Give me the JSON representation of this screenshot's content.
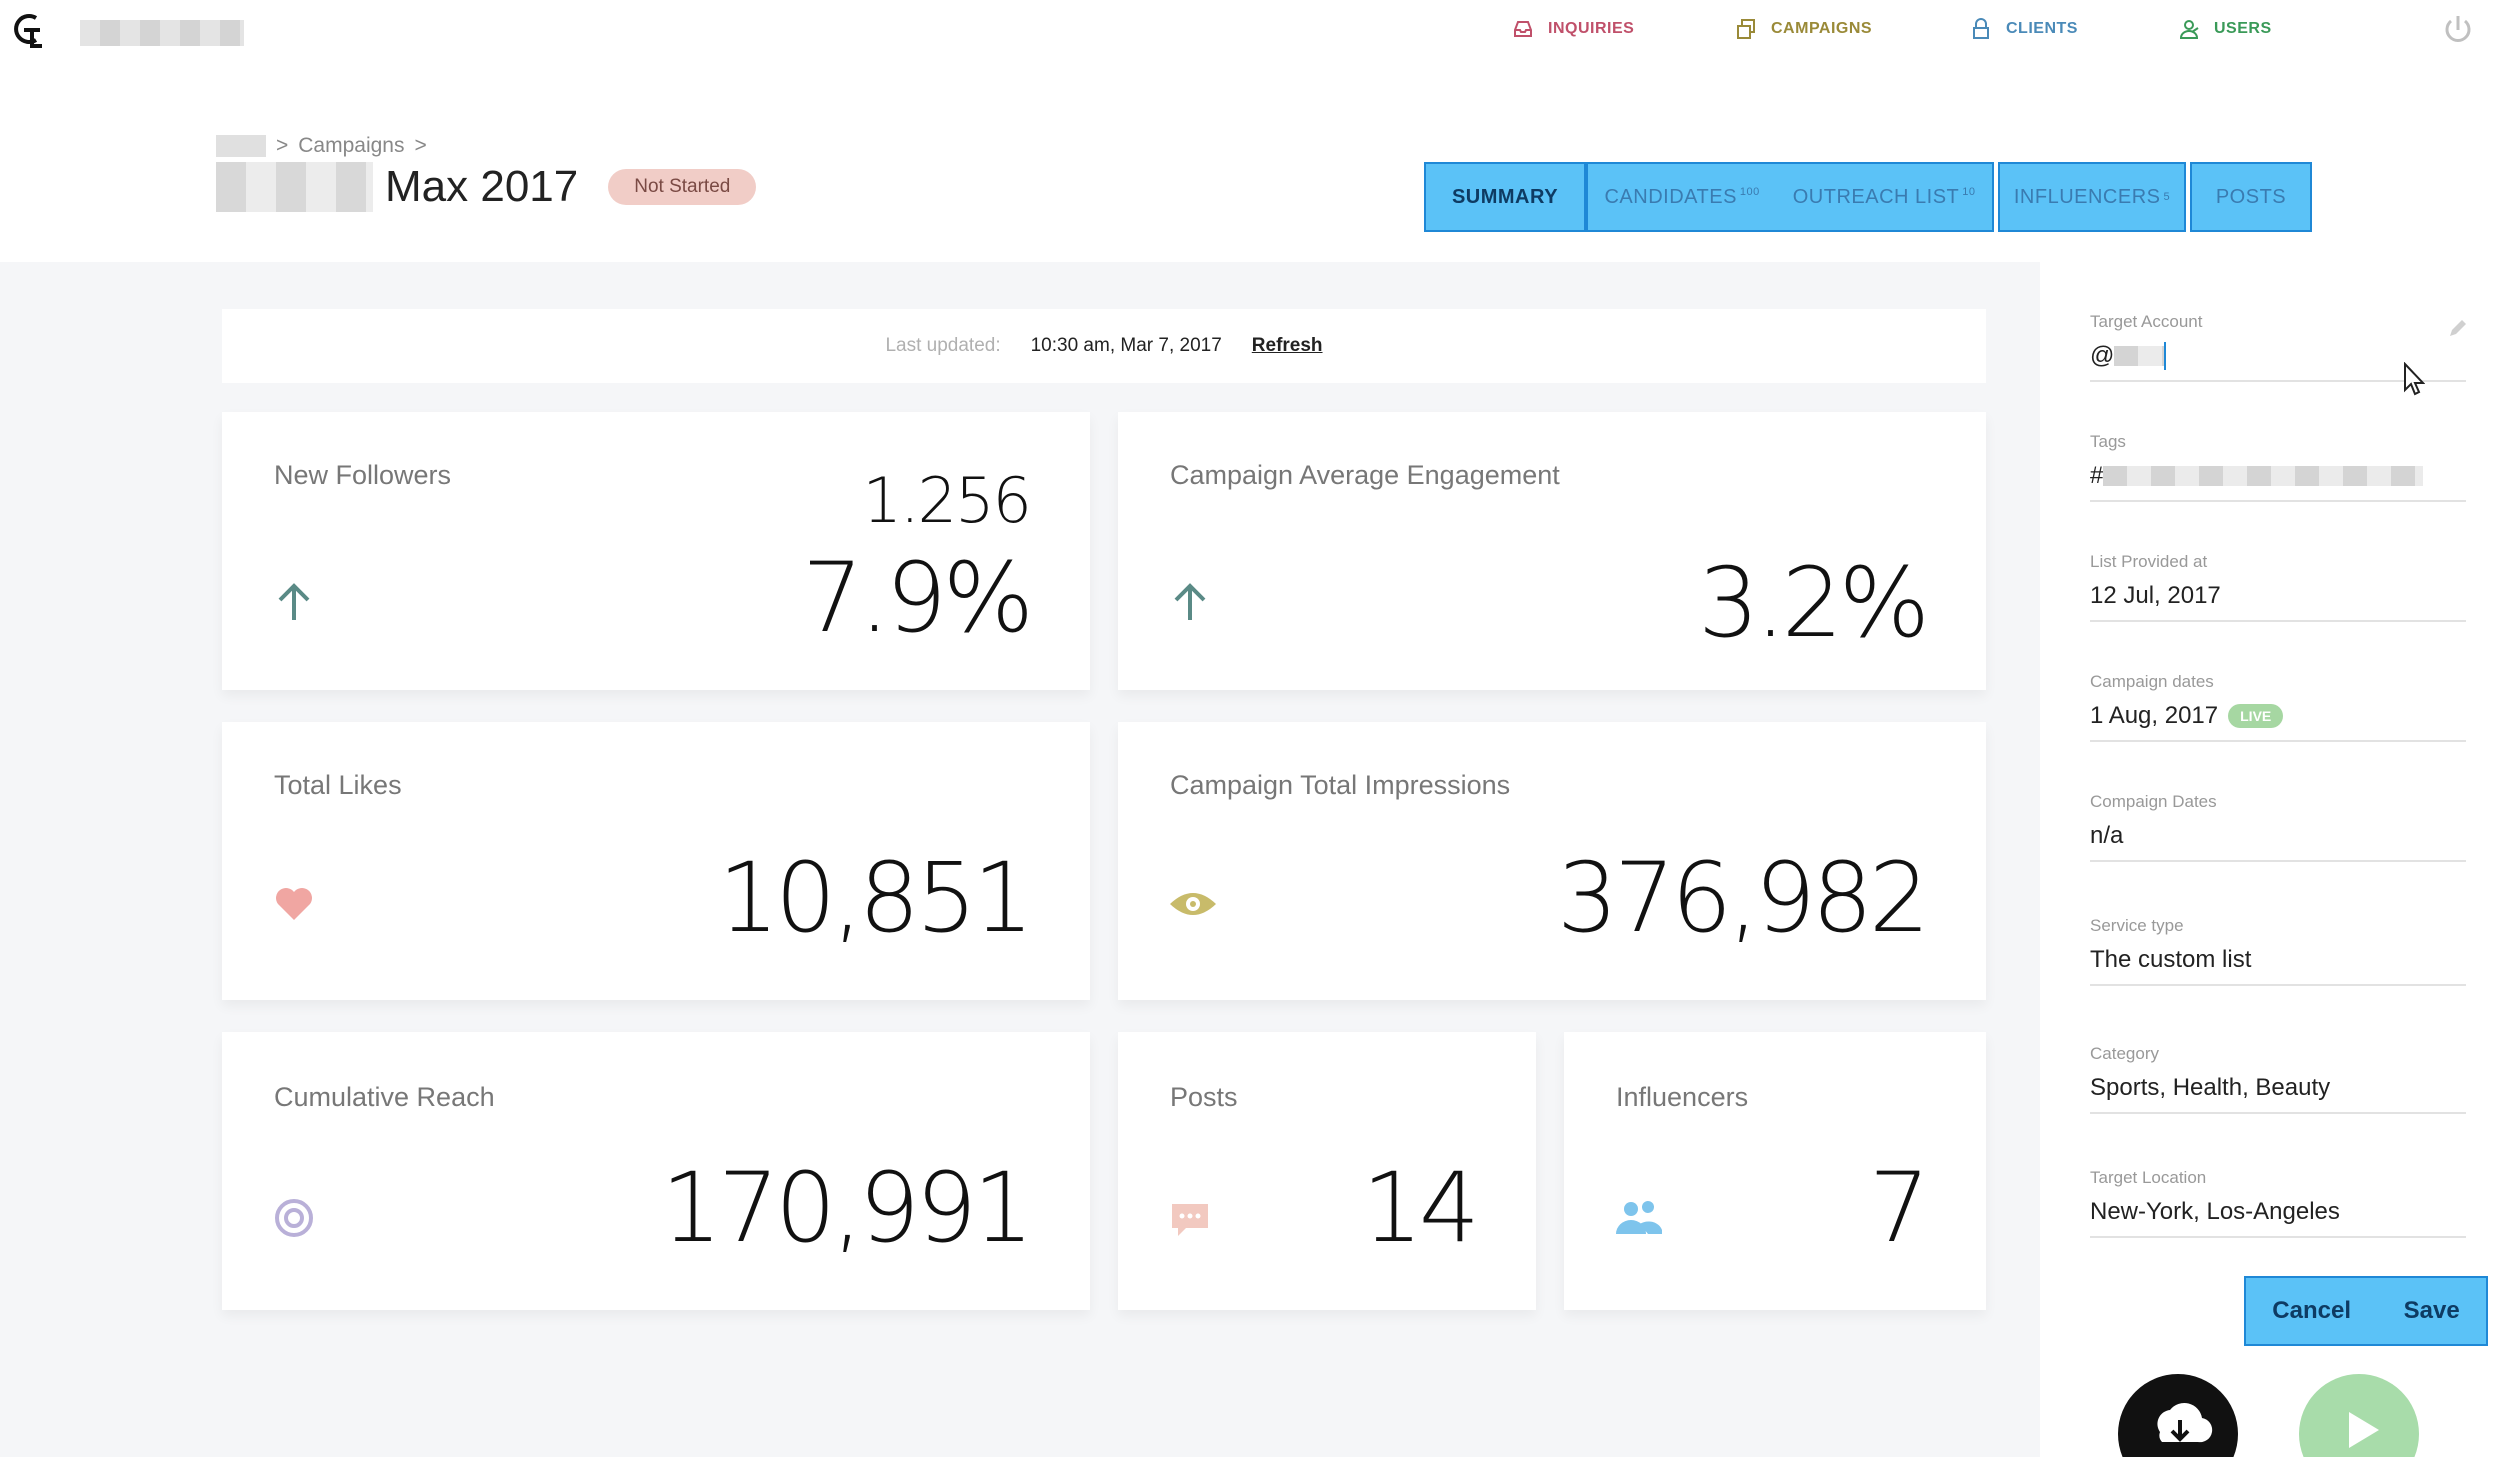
{
  "nav": {
    "inquiries": "INQUIRIES",
    "campaigns": "CAMPAIGNS",
    "clients": "CLIENTS",
    "users": "USERS"
  },
  "breadcrumb": {
    "campaigns": "Campaigns",
    "sep": ">"
  },
  "campaign": {
    "title": "Max 2017",
    "status": "Not Started"
  },
  "tabs": {
    "summary": "SUMMARY",
    "candidates": "CANDIDATES",
    "candidates_count": "100",
    "outreach": "OUTREACH LIST",
    "outreach_count": "10",
    "influencers": "INFLUENCERS",
    "influencers_count": "5",
    "posts": "POSTS"
  },
  "updated": {
    "label": "Last updated:",
    "time": "10:30 am, Mar 7, 2017",
    "refresh": "Refresh"
  },
  "stats": {
    "new_followers": {
      "label": "New Followers",
      "count": "1.256",
      "pct": "7.9%"
    },
    "avg_engagement": {
      "label": "Campaign Average Engagement",
      "pct": "3.2%"
    },
    "total_likes": {
      "label": "Total Likes",
      "value": "10,851"
    },
    "total_impressions": {
      "label": "Campaign Total Impressions",
      "value": "376,982"
    },
    "cumulative_reach": {
      "label": "Cumulative Reach",
      "value": "170,991"
    },
    "posts": {
      "label": "Posts",
      "value": "14"
    },
    "influencers": {
      "label": "Influencers",
      "value": "7"
    }
  },
  "sidebar": {
    "target_account": {
      "label": "Target Account",
      "prefix": "@"
    },
    "tags": {
      "label": "Tags",
      "prefix": "#"
    },
    "list_provided": {
      "label": "List Provided at",
      "value": "12 Jul, 2017"
    },
    "campaign_dates": {
      "label": "Campaign dates",
      "value": "1 Aug, 2017",
      "badge": "LIVE"
    },
    "compaign_dates": {
      "label": "Compaign Dates",
      "value": "n/a"
    },
    "service_type": {
      "label": "Service type",
      "value": "The custom list"
    },
    "category": {
      "label": "Category",
      "value": "Sports, Health, Beauty"
    },
    "target_location": {
      "label": "Target Location",
      "value": "New-York, Los-Angeles"
    },
    "cancel": "Cancel",
    "save": "Save"
  },
  "colors": {
    "accent_tab": "#5bc2f7",
    "tab_border": "#1f88d6",
    "status_pill": "#f1cdc7",
    "live_badge": "#a6d7a2",
    "arrow_up": "#5a8a86",
    "heart": "#f0a6a2",
    "eye": "#c8bb6a",
    "target": "#b9b0d8",
    "chat": "#f2c9c0",
    "people": "#7ec4ec"
  },
  "icons": [
    "inbox-icon",
    "copy-icon",
    "lock-icon",
    "users-icon",
    "power-icon",
    "arrow-up-icon",
    "heart-icon",
    "eye-icon",
    "target-icon",
    "chat-icon",
    "people-icon",
    "pencil-icon",
    "download-icon",
    "play-icon"
  ]
}
